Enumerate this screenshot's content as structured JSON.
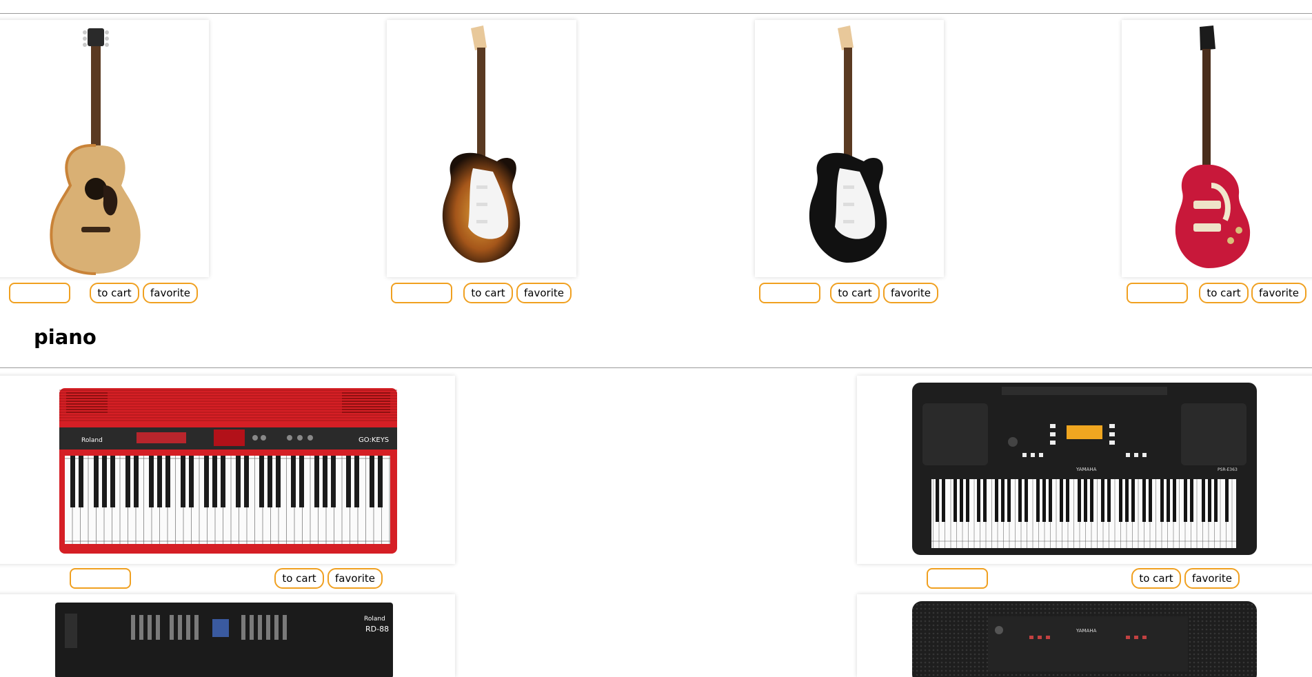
{
  "buttons": {
    "cart_label": "to cart",
    "favorite_label": "favorite"
  },
  "guitar_section": {
    "products": [
      {
        "image": "acoustic-guitar-natural",
        "quantity": ""
      },
      {
        "image": "electric-guitar-sunburst",
        "quantity": ""
      },
      {
        "image": "electric-guitar-black",
        "quantity": ""
      },
      {
        "image": "electric-guitar-red",
        "quantity": ""
      }
    ]
  },
  "piano_section": {
    "title": "piano",
    "products": [
      {
        "image": "keyboard-red",
        "brand": "Roland",
        "model": "GO:KEYS",
        "quantity": ""
      },
      {
        "image": "keyboard-black",
        "brand": "YAMAHA",
        "model": "PSR-E363",
        "quantity": ""
      },
      {
        "image": "synthesizer-black",
        "brand": "Roland",
        "model": "RD-88"
      },
      {
        "image": "keyboard-black-2",
        "brand": "YAMAHA"
      }
    ]
  },
  "colors": {
    "accent": "#f0a020",
    "divider": "#9a9a9a"
  }
}
